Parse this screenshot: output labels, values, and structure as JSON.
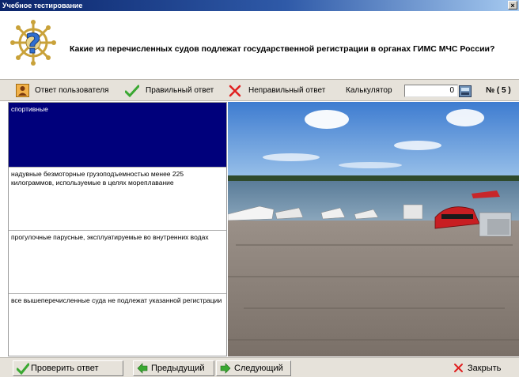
{
  "window": {
    "title": "Учебное тестирование",
    "close_label": "×"
  },
  "question": {
    "text": "Какие из перечисленных судов подлежат государственной регистрации в органах ГИМС МЧС России?"
  },
  "toolbar": {
    "user_answer": "Ответ пользователя",
    "correct_answer": "Правильный ответ",
    "wrong_answer": "Неправильный ответ",
    "calculator_label": "Калькулятор",
    "calculator_value": "0",
    "question_number": "№ ( 5 )"
  },
  "answers": [
    {
      "text": "спортивные",
      "selected": true
    },
    {
      "text": "надувные безмоторные грузоподъемностью менее 225 килограммов, используемые в целях мореплавание",
      "selected": false
    },
    {
      "text": "прогулочные парусные, эксплуатируемые во внутренних водах",
      "selected": false
    },
    {
      "text": "все вышеперечисленные суда не подлежат указанной регистрации",
      "selected": false
    }
  ],
  "buttons": {
    "check": "Проверить ответ",
    "previous": "Предыдущий",
    "next": "Следующий",
    "close": "Закрыть"
  },
  "colors": {
    "selected_bg": "#00007b",
    "title_gradient_start": "#0a246a",
    "check_green": "#3aa832",
    "wrong_red": "#e02020"
  }
}
